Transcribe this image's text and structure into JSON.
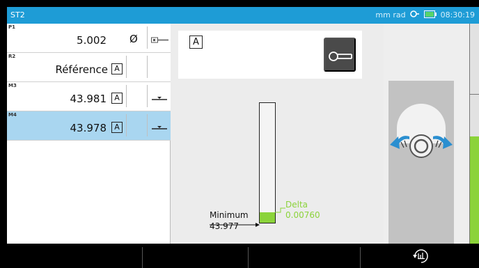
{
  "status": {
    "title": "ST2",
    "units": "mm rad",
    "time": "08:30:19"
  },
  "rows": [
    {
      "code": "P1",
      "value": "5.002",
      "symbol": "Ø",
      "box": "",
      "icon": "probe-small-icon"
    },
    {
      "code": "R2",
      "value": "Référence",
      "symbol": "",
      "box": "A",
      "icon": ""
    },
    {
      "code": "M3",
      "value": "43.981",
      "symbol": "",
      "box": "A",
      "icon": "min-marker-icon"
    },
    {
      "code": "M4",
      "value": "43.978",
      "symbol": "",
      "box": "A",
      "icon": "min-marker-icon",
      "selected": true
    }
  ],
  "gauge": {
    "mode": "A",
    "minimum_label": "Minimum",
    "minimum_value": "43.977",
    "delta_label": "Delta",
    "delta_value": "0.00760",
    "fill_fraction": 0.09
  },
  "colors": {
    "statusbar": "#1e9cd6",
    "selected_row": "#a9d6f0",
    "fill_green": "#8bd33a",
    "arrow_blue": "#2b8fd0"
  },
  "toolbar": {
    "buttons": [
      "",
      "",
      "",
      "refresh-stats-icon"
    ]
  }
}
